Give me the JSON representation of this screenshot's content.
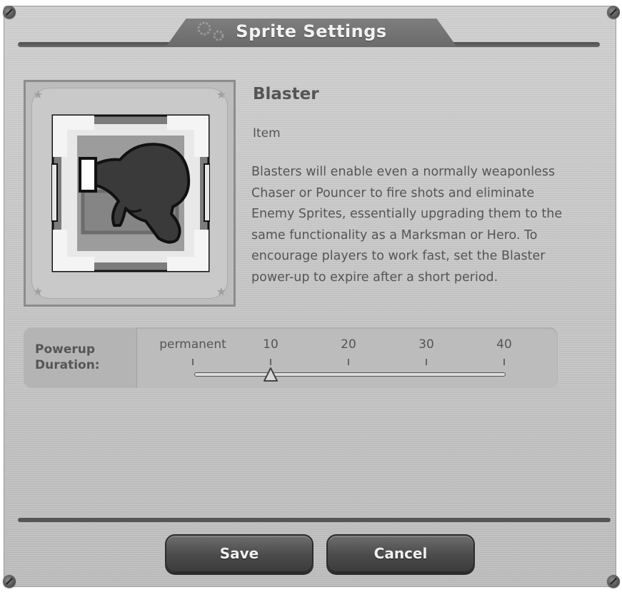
{
  "dialog": {
    "title": "Sprite Settings"
  },
  "sprite": {
    "name": "Blaster",
    "type": "Item",
    "description": "Blasters will enable even a normally weaponless Chaser or Pouncer to fire shots and eliminate Enemy Sprites, essentially upgrading them to the same functionality as a Marksman or Hero. To encourage players to work fast, set the Blaster power-up to expire after a short period.",
    "icon": "blaster-icon"
  },
  "powerup_duration": {
    "label": "Powerup Duration:",
    "ticks": [
      "permanent",
      "10",
      "20",
      "30",
      "40"
    ],
    "selected_value": "10"
  },
  "buttons": {
    "save": "Save",
    "cancel": "Cancel"
  },
  "colors": {
    "panel": "#c8c8c8",
    "button": "#4b4b4b",
    "text": "#555555"
  }
}
